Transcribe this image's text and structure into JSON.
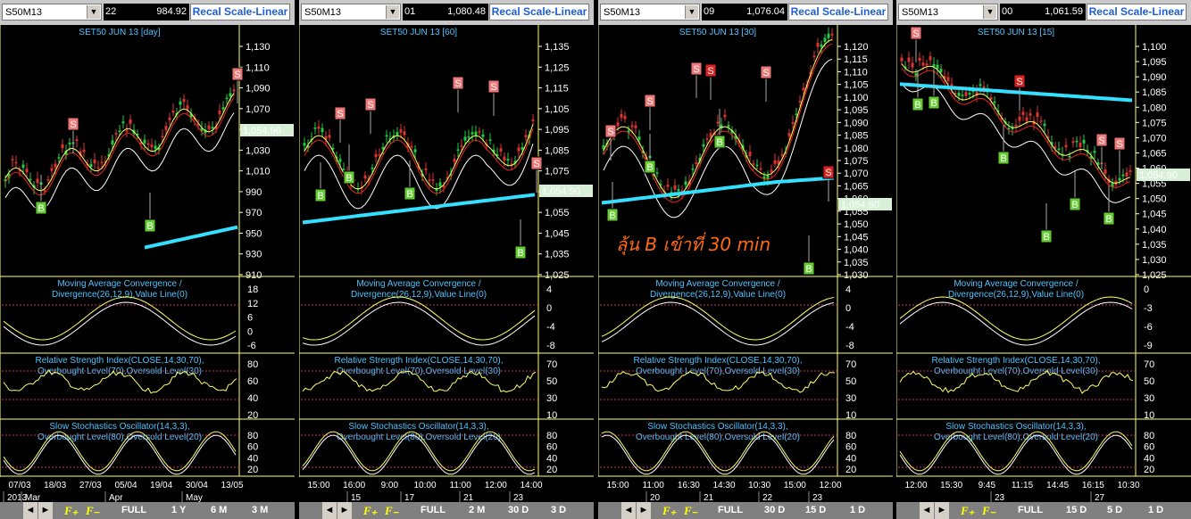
{
  "colors": {
    "buy": "#66cc33",
    "buy_dark": "#0e8a8a",
    "sell": "#dd2222",
    "sell_light": "#ee7777",
    "ma_slow": "#33e0ff",
    "annotation": "#ff6a10"
  },
  "annotation": "ลุ้น B เข้าที่ 30 min",
  "panels": [
    {
      "symbol": "S50M13",
      "frag": "22",
      "price": "984.92",
      "recal": "Recal Scale-Linear",
      "title": "SET50 JUN 13   [day]",
      "last": "1,054.90",
      "yticks": [
        "1,130",
        "1,110",
        "1,090",
        "1,070",
        "1,050",
        "1,030",
        "1,010",
        "990",
        "970",
        "950",
        "930",
        "910"
      ],
      "macd_title": "Moving Average Convergence / Divergence(26,12,9),Value Line(0)",
      "macd_ticks": [
        "18",
        "12",
        "6",
        "0",
        "-6"
      ],
      "rsi_title": "Relative Strength Index(CLOSE,14,30,70),Overbought Level(70),Oversold Level(30)",
      "rsi_ticks": [
        "80",
        "60",
        "40",
        "20"
      ],
      "sto_title": "Slow Stochastics Oscillator(14,3,3),Overbought Level(80),Oversold Level(20)",
      "sto_ticks": [
        "80",
        "60",
        "40",
        "20"
      ],
      "xtop": [
        "07/03",
        "18/03",
        "27/03",
        "05/04",
        "19/04",
        "30/04",
        "13/05"
      ],
      "xbot": [
        "2013",
        "Mar",
        "Apr",
        "May"
      ],
      "nav": {
        "b1": "FULL",
        "b2": "1 Y",
        "b3": "6 M",
        "b4": "3 M"
      }
    },
    {
      "symbol": "S50M13",
      "frag": "01",
      "price": "1,080.48",
      "recal": "Recal Scale-Linear",
      "title": "SET50 JUN 13   [60]",
      "last": "1,054.90",
      "yticks": [
        "1,135",
        "1,125",
        "1,115",
        "1,105",
        "1,095",
        "1,085",
        "1,075",
        "1,065",
        "1,055",
        "1,045",
        "1,035",
        "1,025"
      ],
      "macd_title": "Moving Average Convergence / Divergence(26,12,9),Value Line(0)",
      "macd_ticks": [
        "4",
        "0",
        "-4",
        "-8"
      ],
      "rsi_title": "Relative Strength Index(CLOSE,14,30,70),Overbought Level(70),Oversold Level(30)",
      "rsi_ticks": [
        "70",
        "50",
        "30",
        "10"
      ],
      "sto_title": "Slow Stochastics Oscillator(14,3,3),Overbought Level(80),Oversold Level(20)",
      "sto_ticks": [
        "80",
        "60",
        "40",
        "20"
      ],
      "xtop": [
        "15:00",
        "16:00",
        "9:00",
        "10:00",
        "11:00",
        "12:00",
        "14:00"
      ],
      "xbot": [
        "15",
        "17",
        "21",
        "23"
      ],
      "nav": {
        "b1": "FULL",
        "b2": "2 M",
        "b3": "30 D",
        "b4": "3 D"
      }
    },
    {
      "symbol": "S50M13",
      "frag": "09",
      "price": "1,076.04",
      "recal": "Recal Scale-Linear",
      "title": "SET50 JUN 13   [30]",
      "last": "1,054.90",
      "yticks": [
        "1,120",
        "1,115",
        "1,110",
        "1,105",
        "1,100",
        "1,095",
        "1,090",
        "1,085",
        "1,080",
        "1,075",
        "1,070",
        "1,065",
        "1,060",
        "1,055",
        "1,050",
        "1,045",
        "1,040",
        "1,035",
        "1,030"
      ],
      "macd_title": "Moving Average Convergence / Divergence(26,12,9),Value Line(0)",
      "macd_ticks": [
        "4",
        "0",
        "-4",
        "-8"
      ],
      "rsi_title": "Relative Strength Index(CLOSE,14,30,70),Overbought Level(70),Oversold Level(30)",
      "rsi_ticks": [
        "70",
        "50",
        "30",
        "10"
      ],
      "sto_title": "Slow Stochastics Oscillator(14,3,3),Overbought Level(80),Oversold Level(20)",
      "sto_ticks": [
        "80",
        "60",
        "40",
        "20"
      ],
      "xtop": [
        "15:00",
        "11:00",
        "16:30",
        "14:30",
        "10:30",
        "15:00",
        "12:00"
      ],
      "xbot": [
        "20",
        "21",
        "22",
        "23"
      ],
      "nav": {
        "b1": "FULL",
        "b2": "30 D",
        "b3": "15 D",
        "b4": "1 D"
      }
    },
    {
      "symbol": "S50M13",
      "frag": "00",
      "price": "1,061.59",
      "recal": "Recal Scale-Linear",
      "title": "SET50 JUN 13   [15]",
      "last": "1,054.90",
      "yticks": [
        "1,100",
        "1,095",
        "1,090",
        "1,085",
        "1,080",
        "1,075",
        "1,070",
        "1,065",
        "1,060",
        "1,055",
        "1,050",
        "1,045",
        "1,040",
        "1,035",
        "1,030",
        "1,025"
      ],
      "macd_title": "Moving Average Convergence / Divergence(26,12,9),Value Line(0)",
      "macd_ticks": [
        "0",
        "-3",
        "-6",
        "-9"
      ],
      "rsi_title": "Relative Strength Index(CLOSE,14,30,70),Overbought Level(70),Oversold Level(30)",
      "rsi_ticks": [
        "70",
        "50",
        "30",
        "10"
      ],
      "sto_title": "Slow Stochastics Oscillator(14,3,3),Overbought Level(80),Oversold Level(20)",
      "sto_ticks": [
        "80",
        "60",
        "40",
        "20"
      ],
      "xtop": [
        "12:00",
        "15:30",
        "9:45",
        "11:15",
        "14:45",
        "16:15",
        "10:30"
      ],
      "xbot": [
        "23",
        "27"
      ],
      "nav": {
        "b1": "FULL",
        "b2": "15 D",
        "b3": "5 D",
        "b4": "1 D"
      }
    }
  ]
}
